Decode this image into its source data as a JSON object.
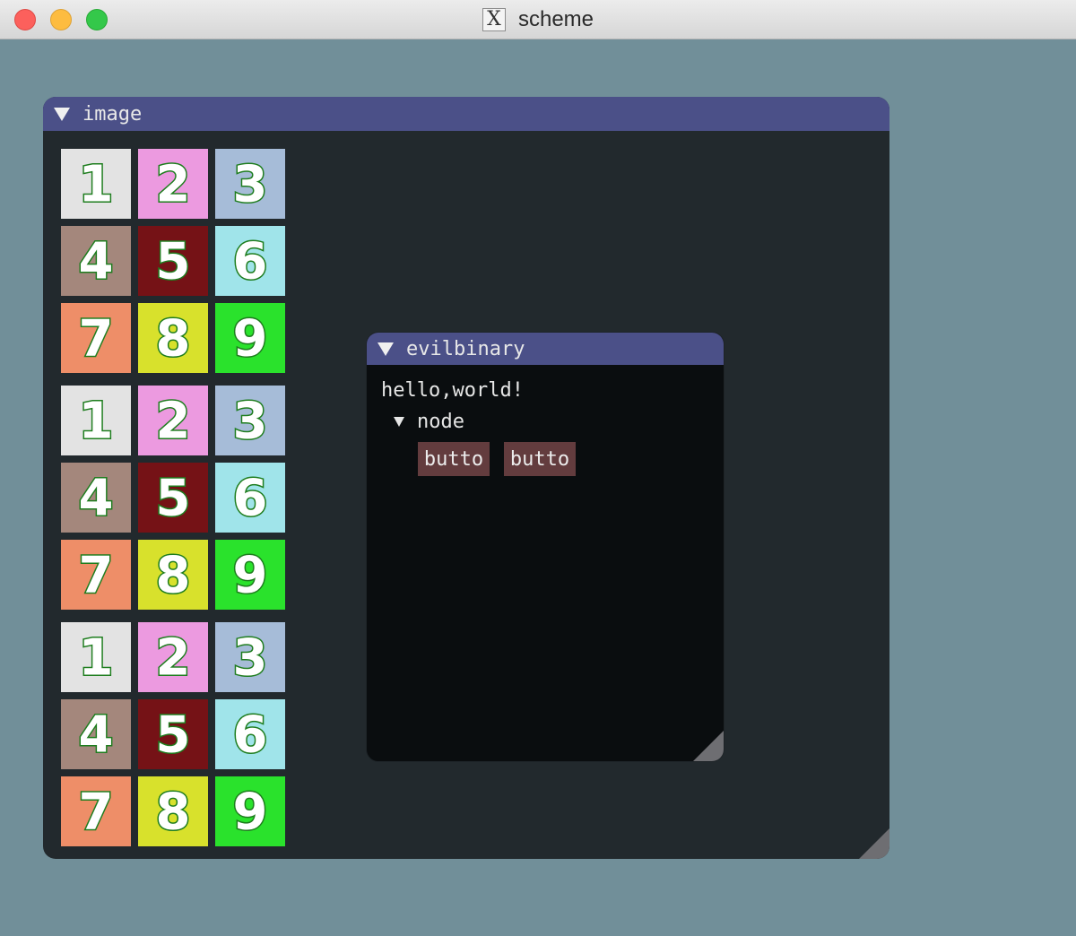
{
  "titlebar": {
    "title": "scheme",
    "app_icon": "X",
    "buttons": [
      "close",
      "minimize",
      "maximize"
    ]
  },
  "image_window": {
    "title": "image",
    "grids": [
      {
        "tiles": [
          {
            "label": "1",
            "color": "#e3e3e3"
          },
          {
            "label": "2",
            "color": "#ec9ae0"
          },
          {
            "label": "3",
            "color": "#a6bcd8"
          },
          {
            "label": "4",
            "color": "#a4877c"
          },
          {
            "label": "5",
            "color": "#751216"
          },
          {
            "label": "6",
            "color": "#a0e4ea"
          },
          {
            "label": "7",
            "color": "#ee8e68"
          },
          {
            "label": "8",
            "color": "#d8e12c"
          },
          {
            "label": "9",
            "color": "#2ae22c"
          }
        ]
      },
      {
        "tiles": [
          {
            "label": "1",
            "color": "#e3e3e3"
          },
          {
            "label": "2",
            "color": "#ec9ae0"
          },
          {
            "label": "3",
            "color": "#a6bcd8"
          },
          {
            "label": "4",
            "color": "#a4877c"
          },
          {
            "label": "5",
            "color": "#751216"
          },
          {
            "label": "6",
            "color": "#a0e4ea"
          },
          {
            "label": "7",
            "color": "#ee8e68"
          },
          {
            "label": "8",
            "color": "#d8e12c"
          },
          {
            "label": "9",
            "color": "#2ae22c"
          }
        ]
      },
      {
        "tiles": [
          {
            "label": "1",
            "color": "#e3e3e3"
          },
          {
            "label": "2",
            "color": "#ec9ae0"
          },
          {
            "label": "3",
            "color": "#a6bcd8"
          },
          {
            "label": "4",
            "color": "#a4877c"
          },
          {
            "label": "5",
            "color": "#751216"
          },
          {
            "label": "6",
            "color": "#a0e4ea"
          },
          {
            "label": "7",
            "color": "#ee8e68"
          },
          {
            "label": "8",
            "color": "#d8e12c"
          },
          {
            "label": "9",
            "color": "#2ae22c"
          }
        ]
      }
    ]
  },
  "evil_window": {
    "title": "evilbinary",
    "text": "hello,world!",
    "node_label": "node",
    "buttons": [
      "butto",
      "butto"
    ]
  },
  "colors": {
    "desktop": "#718f99",
    "window_header": "#4b5088",
    "digit_outline": "#1e7d1e",
    "button_bg": "#633c3e"
  }
}
